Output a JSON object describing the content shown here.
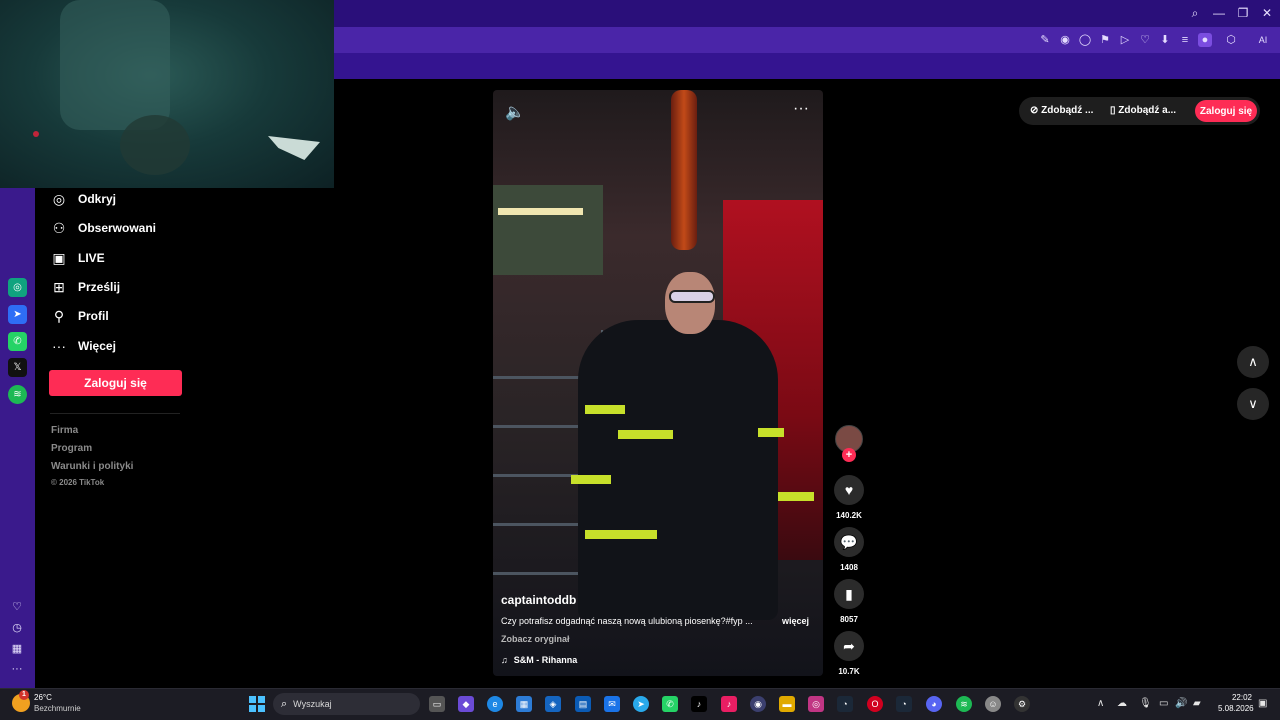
{
  "browser": {
    "winbtns": [
      "⌕",
      "—",
      "❐",
      "✕"
    ],
    "toolbar_icons": [
      "✎",
      "◉",
      "◯",
      "⚑",
      "▷",
      "♡",
      "⬇",
      "≡",
      "●",
      "⬡",
      "AI"
    ]
  },
  "sidebar_left_rail": {
    "apps": [
      "chatgpt-icon",
      "messenger-icon",
      "whatsapp-icon",
      "x-icon",
      "spotify-icon"
    ],
    "bottom_icons": [
      "heart-icon",
      "clock-icon",
      "box-icon",
      "more-icon"
    ]
  },
  "tiktok_nav": {
    "items": [
      {
        "label": "Odkryj",
        "icon": "◎"
      },
      {
        "label": "Obserwowani",
        "icon": "⚇"
      },
      {
        "label": "LIVE",
        "icon": "▣"
      },
      {
        "label": "Prześlij",
        "icon": "⊞"
      },
      {
        "label": "Profil",
        "icon": "⚲"
      },
      {
        "label": "Więcej",
        "icon": "···"
      }
    ],
    "login_button": "Zaloguj się",
    "footer_links": [
      "Firma",
      "Program",
      "Warunki i polityki"
    ],
    "copyright": "© 2026 TikTok"
  },
  "video": {
    "username": "captaintoddb",
    "description": "Czy potrafisz odgadnąć naszą nową ulubioną piosenkę?#fyp ...",
    "more": "więcej",
    "see_original": "Zobacz oryginał",
    "music": "S&M - Rihanna",
    "volume_icon": "🔈",
    "menu_icon": "···"
  },
  "actions": {
    "likes": "140.2K",
    "comments": "1408",
    "saves": "8057",
    "shares": "10.7K"
  },
  "topright": {
    "item1": "Zdobądź ...",
    "item2": "Zdobądź a...",
    "login": "Zaloguj się"
  },
  "taskbar": {
    "weather_temp": "26°C",
    "weather_desc": "Bezchmurnie",
    "weather_badge": "1",
    "search_placeholder": "Wyszukaj",
    "time": "22:02",
    "date": "5.08.2026"
  },
  "colors": {
    "accent": "#fe2c55",
    "browser_purple": "#4a25a8"
  }
}
